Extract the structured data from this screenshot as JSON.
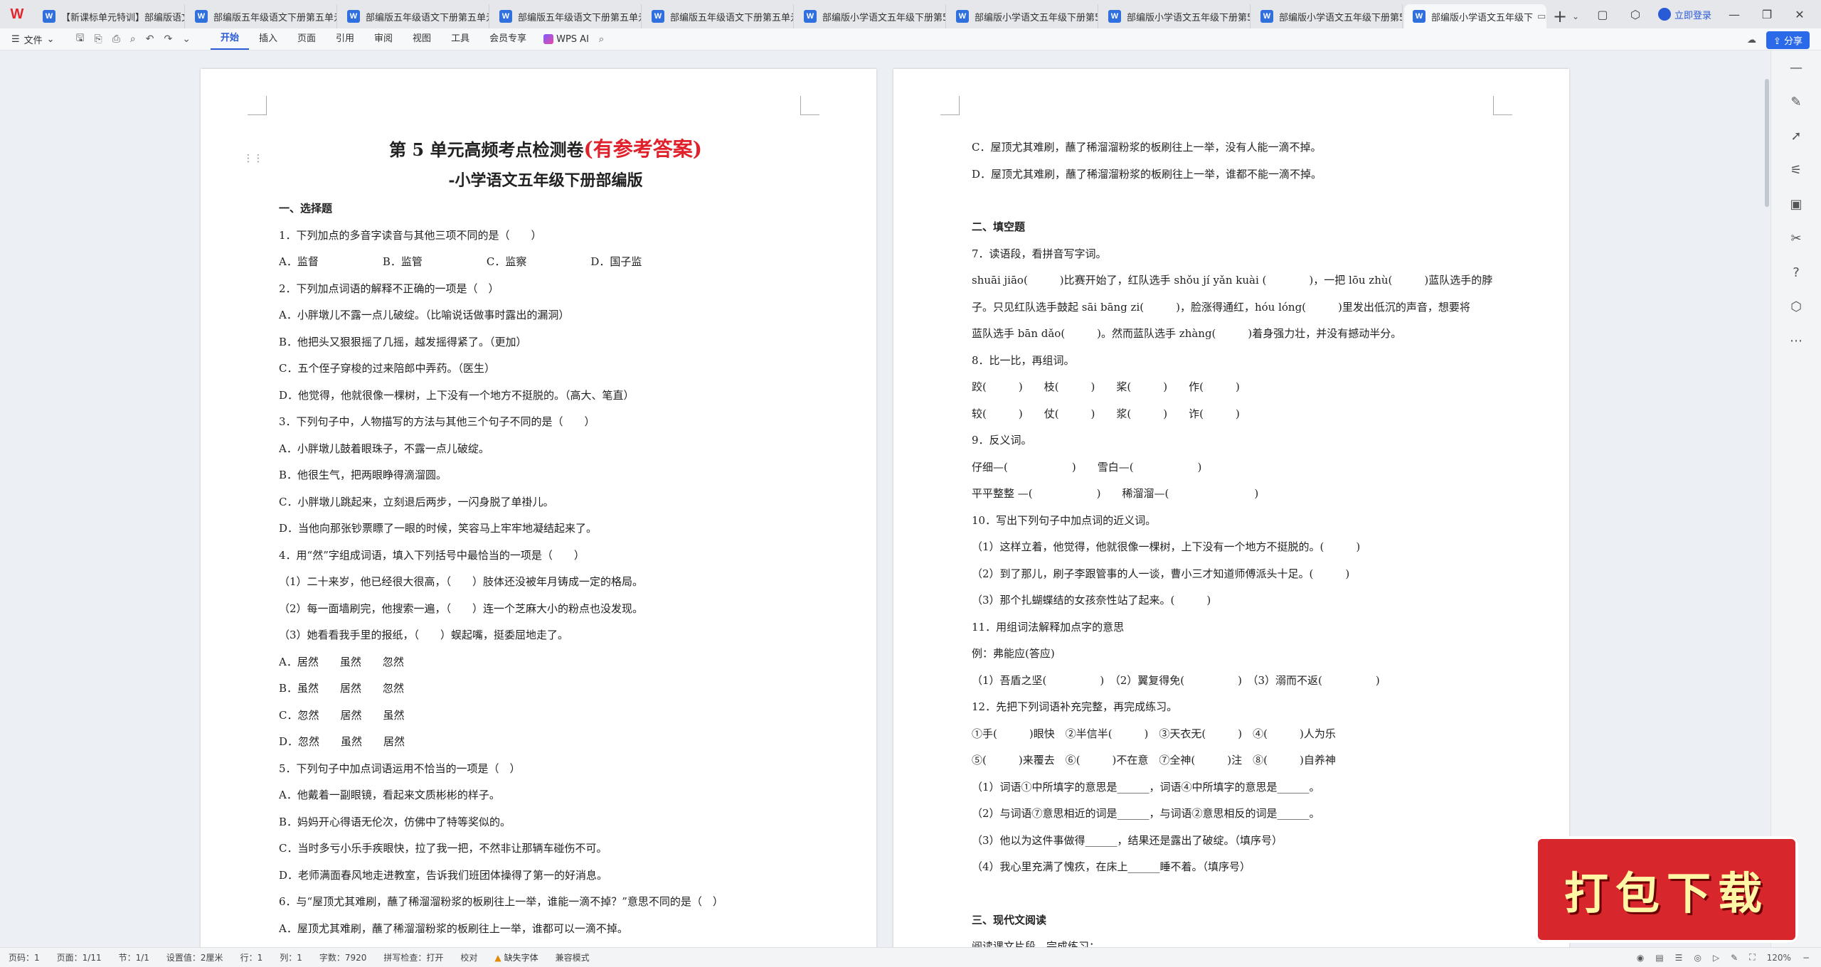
{
  "tabs": [
    {
      "icon": "W",
      "label": "【新课标单元特训】部编版语文"
    },
    {
      "icon": "W",
      "label": "部编版五年级语文下册第五单元"
    },
    {
      "icon": "W",
      "label": "部编版五年级语文下册第五单元"
    },
    {
      "icon": "W",
      "label": "部编版五年级语文下册第五单元"
    },
    {
      "icon": "W",
      "label": "部编版五年级语文下册第五单元"
    },
    {
      "icon": "W",
      "label": "部编版小学语文五年级下册第5"
    },
    {
      "icon": "W",
      "label": "部编版小学语文五年级下册第5"
    },
    {
      "icon": "W",
      "label": "部编版小学语文五年级下册第5"
    },
    {
      "icon": "W",
      "label": "部编版小学语文五年级下册第5"
    }
  ],
  "active_tab": {
    "icon": "W",
    "label": "部编版小学语文五年级下"
  },
  "titlebar": {
    "login": "立即登录"
  },
  "ribbon": {
    "file": "文件",
    "menus": [
      "开始",
      "插入",
      "页面",
      "引用",
      "审阅",
      "视图",
      "工具",
      "会员专享"
    ],
    "ai": "WPS AI",
    "share": "分享"
  },
  "page1": {
    "title": "第 5 单元高频考点检测卷",
    "title_red": "(有参考答案)",
    "subtitle": "-小学语文五年级下册部编版",
    "lines": [
      {
        "t": "一、选择题",
        "h": true
      },
      {
        "t": "1．下列加点的多音字读音与其他三项不同的是（　　）"
      },
      {
        "t": "A．监督　　　　　　B．监管　　　　　　C．监察　　　　　　D．国子监"
      },
      {
        "t": "2．下列加点词语的解释不正确的一项是（　）"
      },
      {
        "t": "A．小胖墩儿不露一点儿破绽。（比喻说话做事时露出的漏洞）"
      },
      {
        "t": "B．他把头又狠狠摇了几摇，越发摇得紧了。（更加）"
      },
      {
        "t": "C．五个侄子穿梭的过来陪郎中弄药。（医生）"
      },
      {
        "t": "D．他觉得，他就很像一棵树，上下没有一个地方不挺脱的。（高大、笔直）"
      },
      {
        "t": "3．下列句子中，人物描写的方法与其他三个句子不同的是（　　）"
      },
      {
        "t": "A．小胖墩儿鼓着眼珠子，不露一点儿破绽。"
      },
      {
        "t": "B．他很生气，把两眼睁得滴溜圆。"
      },
      {
        "t": "C．小胖墩儿跳起来，立刻退后两步，一闪身脱了单褂儿。"
      },
      {
        "t": "D．当他向那张钞票瞟了一眼的时候，笑容马上牢牢地凝结起来了。"
      },
      {
        "t": "4．用“然”字组成词语，填入下列括号中最恰当的一项是（　　）"
      },
      {
        "t": "（1）二十来岁，他已经很大很高，（　　）肢体还没被年月铸成一定的格局。"
      },
      {
        "t": "（2）每一面墙刷完，他搜索一遍，（　　）连一个芝麻大小的粉点也没发现。"
      },
      {
        "t": "（3）她看看我手里的报纸，（　　）蜈起嘴，挺委屈地走了。"
      },
      {
        "t": "A．居然　　虽然　　忽然"
      },
      {
        "t": "B．虽然　　居然　　忽然"
      },
      {
        "t": "C．忽然　　居然　　虽然"
      },
      {
        "t": "D．忽然　　虽然　　居然"
      },
      {
        "t": "5．下列句子中加点词语运用不恰当的一项是（　）"
      },
      {
        "t": "A．他戴着一副眼镜，看起来文质彬彬的样子。"
      },
      {
        "t": "B．妈妈开心得语无伦次，仿佛中了特等奖似的。"
      },
      {
        "t": "C．当时多亏小乐手疾眼快，拉了我一把，不然非让那辆车碰伤不可。"
      },
      {
        "t": "D．老师满面春风地走进教室，告诉我们班团体操得了第一的好消息。"
      },
      {
        "t": "6．与“屋顶尤其难刷，蘸了稀溜溜粉浆的板刷往上一举，谁能一滴不掉？”意思不同的是（　）"
      },
      {
        "t": "A．屋顶尤其难刷，蘸了稀溜溜粉浆的板刷往上一举，谁都可以一滴不掉。"
      }
    ]
  },
  "page2": {
    "lines": [
      {
        "t": "C．屋顶尤其难刷，蘸了稀溜溜粉浆的板刷往上一举，没有人能一滴不掉。"
      },
      {
        "t": "D．屋顶尤其难刷，蘸了稀溜溜粉浆的板刷往上一举，谁都不能一滴不掉。"
      },
      {
        "t": "",
        "gap": true
      },
      {
        "t": "二、填空题",
        "h": true
      },
      {
        "t": "7．读语段，看拼音写字词。"
      },
      {
        "t": "shuāi jiāo(　　　)比赛开始了，红队选手 shǒu jí yǎn kuài (　　　　)，一把 lōu zhù(　　　)蓝队选手的脖"
      },
      {
        "t": "子。只见红队选手鼓起 sāi bāng zi(　　　)，脸涨得通红，hóu lóng(　　　)里发出低沉的声音，想要将"
      },
      {
        "t": "蓝队选手 bān dǎo(　　　)。然而蓝队选手 zhàng(　　　)着身强力壮，并没有撼动半分。"
      },
      {
        "t": "8．比一比，再组词。"
      },
      {
        "t": "跤(　　　)　　枝(　　　)　　桨(　　　)　　作(　　　)"
      },
      {
        "t": "较(　　　)　　仗(　　　)　　浆(　　　)　　诈(　　　)"
      },
      {
        "t": "9．反义词。"
      },
      {
        "t": "仔细—(　　　　　　)　　雪白—(　　　　　　)"
      },
      {
        "t": "平平整整 —(　　　　　　)　　稀溜溜—(　　　　　　　　)"
      },
      {
        "t": "10．写出下列句子中加点词的近义词。"
      },
      {
        "t": "（1）这样立着，他觉得，他就很像一棵树，上下没有一个地方不挺脱的。(　　　)"
      },
      {
        "t": "（2）到了那儿，刷子李跟管事的人一谈，曹小三才知道师傅派头十足。(　　　)"
      },
      {
        "t": "（3）那个扎蝴蝶结的女孩奈性站了起来。(　　　)"
      },
      {
        "t": "11．用组词法解释加点字的意思"
      },
      {
        "t": "例：弗能应(答应)"
      },
      {
        "t": "（1）吾盾之坚(　　　　　)　（2）翼复得免(　　　　　)　（3）溺而不返(　　　　　)"
      },
      {
        "t": "12．先把下列词语补充完整，再完成练习。"
      },
      {
        "t": "①手(　　　)眼快　②半信半(　　　)　③天衣无(　　　)　④(　　　)人为乐"
      },
      {
        "t": "⑤(　　　)来覆去　⑥(　　　)不在意　⑦全神(　　　)注　⑧(　　　)自养神"
      },
      {
        "t": "（1）词语①中所填字的意思是______，词语④中所填字的意思是______。"
      },
      {
        "t": "（2）与词语⑦意思相近的词是______，与词语②意思相反的词是______。"
      },
      {
        "t": "（3）他以为这件事做得______，结果还是露出了破绽。（填序号）"
      },
      {
        "t": "（4）我心里充满了愧疚，在床上______睡不着。（填序号）"
      },
      {
        "t": "",
        "gap": true
      },
      {
        "t": "三、现代文阅读",
        "h": true
      },
      {
        "t": "阅读课文片段，完成练习："
      }
    ]
  },
  "status": {
    "page_count": "页码：1",
    "page": "页面：1/11",
    "section": "节：1/1",
    "setting": "设置值：2厘米",
    "row": "行：1",
    "col": "列：1",
    "words": "字数：7920",
    "spell": "拼写检查：打开",
    "proof": "校对",
    "missing_font": "缺失字体",
    "compat": "兼容模式",
    "zoom": "120%"
  },
  "badge": "打包下载"
}
